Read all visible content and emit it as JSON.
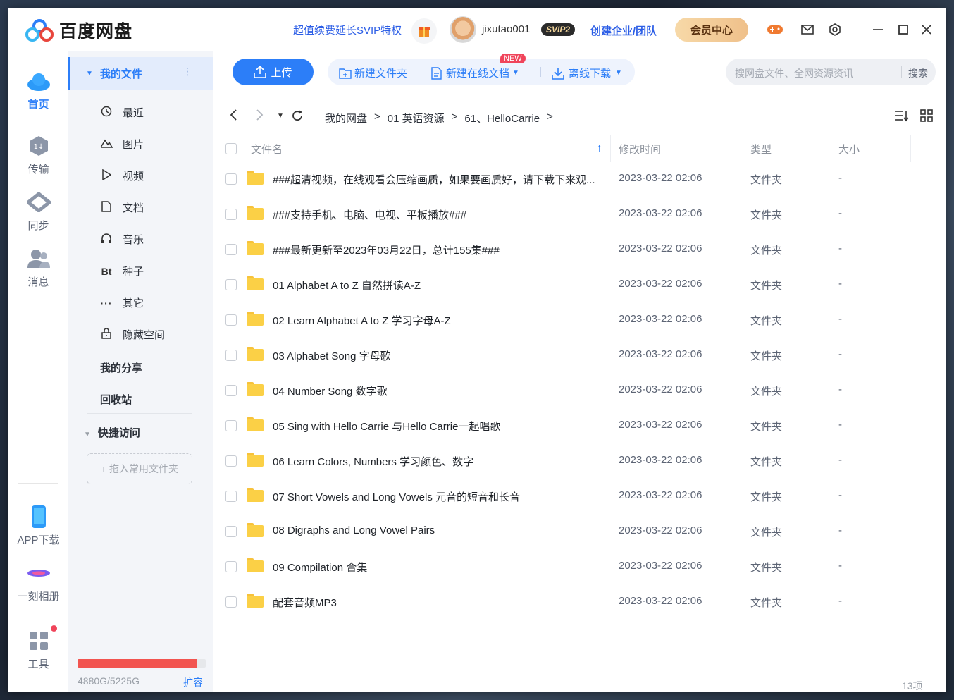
{
  "app": {
    "logo_text": "百度网盘",
    "promo": "超值续费延长SVIP特权",
    "username": "jixutao001",
    "svip_badge": "SVIP2",
    "enterprise": "创建企业/团队",
    "vip_center": "会员中心"
  },
  "rail": {
    "home": "首页",
    "transfer": "传输",
    "sync": "同步",
    "messages": "消息",
    "app_download": "APP下载",
    "album": "一刻相册",
    "tools": "工具"
  },
  "sidebar": {
    "my_files": "我的文件",
    "items": [
      {
        "label": "最近",
        "icon": "clock-icon"
      },
      {
        "label": "图片",
        "icon": "mountain-icon"
      },
      {
        "label": "视频",
        "icon": "play-icon"
      },
      {
        "label": "文档",
        "icon": "document-icon"
      },
      {
        "label": "音乐",
        "icon": "headphones-icon"
      },
      {
        "label": "种子",
        "icon": "bt-icon"
      },
      {
        "label": "其它",
        "icon": "dots-icon"
      },
      {
        "label": "隐藏空间",
        "icon": "lock-icon"
      }
    ],
    "my_share": "我的分享",
    "recycle": "回收站",
    "quick_access": "快捷访问",
    "drop_hint": "+ 拖入常用文件夹",
    "quota_text": "4880G/5225G",
    "quota_used": 4880,
    "quota_total": 5225,
    "expand": "扩容"
  },
  "toolbar": {
    "upload": "上传",
    "new_folder": "新建文件夹",
    "new_doc": "新建在线文档",
    "new_badge": "NEW",
    "offline_download": "离线下载",
    "search_placeholder": "搜网盘文件、全网资源资讯",
    "search_button": "搜索"
  },
  "breadcrumb": [
    "我的网盘",
    ">",
    "01 英语资源",
    ">",
    "61、HelloCarrie",
    ">"
  ],
  "table": {
    "headers": {
      "name": "文件名",
      "modified": "修改时间",
      "type": "类型",
      "size": "大小"
    },
    "rows": [
      {
        "name": "###超清视频，在线观看会压缩画质，如果要画质好，请下载下来观...",
        "time": "2023-03-22 02:06",
        "type": "文件夹",
        "size": "-"
      },
      {
        "name": "###支持手机、电脑、电视、平板播放###",
        "time": "2023-03-22 02:06",
        "type": "文件夹",
        "size": "-"
      },
      {
        "name": "###最新更新至2023年03月22日，总计155集###",
        "time": "2023-03-22 02:06",
        "type": "文件夹",
        "size": "-"
      },
      {
        "name": "01 Alphabet A to Z 自然拼读A-Z",
        "time": "2023-03-22 02:06",
        "type": "文件夹",
        "size": "-"
      },
      {
        "name": "02 Learn Alphabet A to Z 学习字母A-Z",
        "time": "2023-03-22 02:06",
        "type": "文件夹",
        "size": "-"
      },
      {
        "name": "03 Alphabet Song 字母歌",
        "time": "2023-03-22 02:06",
        "type": "文件夹",
        "size": "-"
      },
      {
        "name": "04 Number Song 数字歌",
        "time": "2023-03-22 02:06",
        "type": "文件夹",
        "size": "-"
      },
      {
        "name": "05 Sing with Hello Carrie 与Hello Carrie一起唱歌",
        "time": "2023-03-22 02:06",
        "type": "文件夹",
        "size": "-"
      },
      {
        "name": "06 Learn Colors, Numbers 学习颜色、数字",
        "time": "2023-03-22 02:06",
        "type": "文件夹",
        "size": "-"
      },
      {
        "name": "07 Short Vowels and Long Vowels 元音的短音和长音",
        "time": "2023-03-22 02:06",
        "type": "文件夹",
        "size": "-"
      },
      {
        "name": "08 Digraphs and Long Vowel Pairs",
        "time": "2023-03-22 02:06",
        "type": "文件夹",
        "size": "-"
      },
      {
        "name": "09 Compilation 合集",
        "time": "2023-03-22 02:06",
        "type": "文件夹",
        "size": "-"
      },
      {
        "name": "配套音频MP3",
        "time": "2023-03-22 02:06",
        "type": "文件夹",
        "size": "-"
      }
    ],
    "count": "13项"
  },
  "colors": {
    "accent": "#2c7ef8",
    "quota": "#f25450",
    "folder": "#fbd046"
  }
}
